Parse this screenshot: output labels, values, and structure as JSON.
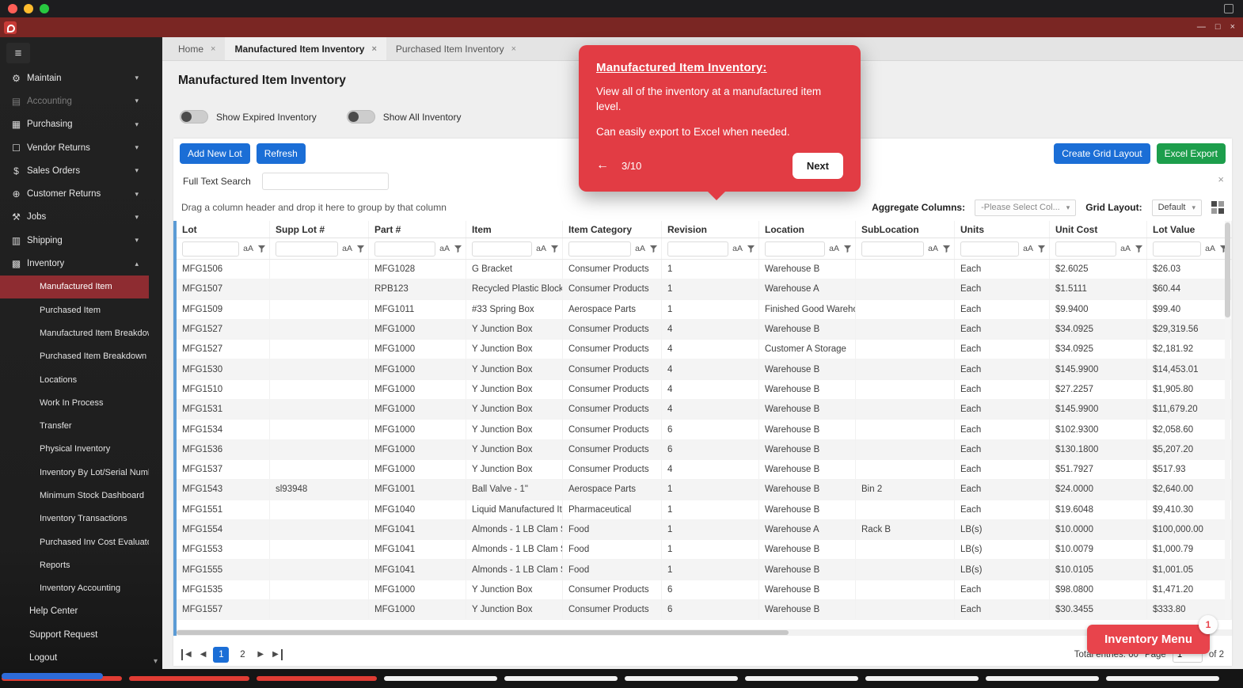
{
  "colors": {
    "primary_blue": "#1b6ed6",
    "export_green": "#1d9e4c",
    "tooltip_red": "#e23c44",
    "titlebar_maroon": "#7a2623",
    "sidebar_selected_red": "#8e2c31",
    "menu_button_red": "#e8444c",
    "accent_bar_blue": "#5b9bd5",
    "traffic_red": "#ff5f57",
    "traffic_yellow": "#febc2e",
    "traffic_green": "#28c840"
  },
  "icons": {
    "menu": "≡",
    "gear": "⚙",
    "folder": "▤",
    "purchasing": "▦",
    "vendor": "☐",
    "dollar": "$",
    "globe": "⊕",
    "wrench": "⚒",
    "shipping": "▥",
    "inventory": "▩",
    "chevron_down": "▾",
    "chevron_up": "▴",
    "close": "×",
    "minimize": "—",
    "restore": "□",
    "back_arrow": "←",
    "caret_down": "▾",
    "pager_prev": "◀",
    "pager_next": "▶"
  },
  "sidebar": {
    "sections": [
      {
        "label": "Maintain",
        "icon": "gear"
      },
      {
        "label": "Accounting",
        "icon": "folder",
        "disabled": true
      },
      {
        "label": "Purchasing",
        "icon": "purchasing"
      },
      {
        "label": "Vendor Returns",
        "icon": "vendor"
      },
      {
        "label": "Sales Orders",
        "icon": "dollar"
      },
      {
        "label": "Customer Returns",
        "icon": "globe"
      },
      {
        "label": "Jobs",
        "icon": "wrench"
      },
      {
        "label": "Shipping",
        "icon": "shipping"
      },
      {
        "label": "Inventory",
        "icon": "inventory",
        "expanded": true
      }
    ],
    "inventory_items": [
      "Manufactured Item",
      "Purchased Item",
      "Manufactured Item Breakdow",
      "Purchased Item Breakdown",
      "Locations",
      "Work In Process",
      "Transfer",
      "Physical Inventory",
      "Inventory By Lot/Serial Numb",
      "Minimum Stock Dashboard",
      "Inventory Transactions",
      "Purchased Inv Cost Evaluator",
      "Reports",
      "Inventory Accounting"
    ],
    "active_index": 0,
    "footer_items": [
      "Help Center",
      "Support Request",
      "Logout"
    ]
  },
  "tabs": [
    {
      "label": "Home"
    },
    {
      "label": "Manufactured Item Inventory",
      "active": true
    },
    {
      "label": "Purchased Item Inventory"
    }
  ],
  "page": {
    "title": "Manufactured Item Inventory"
  },
  "toggles": [
    {
      "label": "Show Expired Inventory",
      "on": false
    },
    {
      "label": "Show All Inventory",
      "on": false
    }
  ],
  "toolbar": {
    "add_new_lot": "Add New Lot",
    "refresh": "Refresh",
    "create_grid_layout": "Create Grid Layout",
    "excel_export": "Excel Export"
  },
  "search": {
    "label": "Full Text Search",
    "value": ""
  },
  "group_hint": "Drag a column header and drop it here to group by that column",
  "aggregate": {
    "label": "Aggregate Columns:",
    "value": "-Please Select Col..."
  },
  "grid_layout": {
    "label": "Grid Layout:",
    "value": "Default"
  },
  "grid": {
    "columns": [
      "Lot",
      "Supp Lot #",
      "Part #",
      "Item",
      "Item Category",
      "Revision",
      "Location",
      "SubLocation",
      "Units",
      "Unit Cost",
      "Lot Value"
    ],
    "filter_case_label": "aA",
    "rows": [
      [
        "MFG1506",
        "",
        "MFG1028",
        "G Bracket",
        "Consumer Products",
        "1",
        "Warehouse B",
        "",
        "Each",
        "$2.6025",
        "$26.03"
      ],
      [
        "MFG1507",
        "",
        "RPB123",
        "Recycled Plastic Block",
        "Consumer Products",
        "1",
        "Warehouse A",
        "",
        "Each",
        "$1.5111",
        "$60.44"
      ],
      [
        "MFG1509",
        "",
        "MFG1011",
        "#33 Spring Box",
        "Aerospace Parts",
        "1",
        "Finished Good Wareho",
        "",
        "Each",
        "$9.9400",
        "$99.40"
      ],
      [
        "MFG1527",
        "",
        "MFG1000",
        "Y Junction Box",
        "Consumer Products",
        "4",
        "Warehouse B",
        "",
        "Each",
        "$34.0925",
        "$29,319.56"
      ],
      [
        "MFG1527",
        "",
        "MFG1000",
        "Y Junction Box",
        "Consumer Products",
        "4",
        "Customer A Storage",
        "",
        "Each",
        "$34.0925",
        "$2,181.92"
      ],
      [
        "MFG1530",
        "",
        "MFG1000",
        "Y Junction Box",
        "Consumer Products",
        "4",
        "Warehouse B",
        "",
        "Each",
        "$145.9900",
        "$14,453.01"
      ],
      [
        "MFG1510",
        "",
        "MFG1000",
        "Y Junction Box",
        "Consumer Products",
        "4",
        "Warehouse B",
        "",
        "Each",
        "$27.2257",
        "$1,905.80"
      ],
      [
        "MFG1531",
        "",
        "MFG1000",
        "Y Junction Box",
        "Consumer Products",
        "4",
        "Warehouse B",
        "",
        "Each",
        "$145.9900",
        "$11,679.20"
      ],
      [
        "MFG1534",
        "",
        "MFG1000",
        "Y Junction Box",
        "Consumer Products",
        "6",
        "Warehouse B",
        "",
        "Each",
        "$102.9300",
        "$2,058.60"
      ],
      [
        "MFG1536",
        "",
        "MFG1000",
        "Y Junction Box",
        "Consumer Products",
        "6",
        "Warehouse B",
        "",
        "Each",
        "$130.1800",
        "$5,207.20"
      ],
      [
        "MFG1537",
        "",
        "MFG1000",
        "Y Junction Box",
        "Consumer Products",
        "4",
        "Warehouse B",
        "",
        "Each",
        "$51.7927",
        "$517.93"
      ],
      [
        "MFG1543",
        "sl93948",
        "MFG1001",
        "Ball Valve - 1\"",
        "Aerospace Parts",
        "1",
        "Warehouse B",
        "Bin 2",
        "Each",
        "$24.0000",
        "$2,640.00"
      ],
      [
        "MFG1551",
        "",
        "MFG1040",
        "Liquid Manufactured It",
        "Pharmaceutical",
        "1",
        "Warehouse B",
        "",
        "Each",
        "$19.6048",
        "$9,410.30"
      ],
      [
        "MFG1554",
        "",
        "MFG1041",
        "Almonds - 1 LB Clam S",
        "Food",
        "1",
        "Warehouse A",
        "Rack B",
        "LB(s)",
        "$10.0000",
        "$100,000.00"
      ],
      [
        "MFG1553",
        "",
        "MFG1041",
        "Almonds - 1 LB Clam S",
        "Food",
        "1",
        "Warehouse B",
        "",
        "LB(s)",
        "$10.0079",
        "$1,000.79"
      ],
      [
        "MFG1555",
        "",
        "MFG1041",
        "Almonds - 1 LB Clam S",
        "Food",
        "1",
        "Warehouse B",
        "",
        "LB(s)",
        "$10.0105",
        "$1,001.05"
      ],
      [
        "MFG1535",
        "",
        "MFG1000",
        "Y Junction Box",
        "Consumer Products",
        "6",
        "Warehouse B",
        "",
        "Each",
        "$98.0800",
        "$1,471.20"
      ],
      [
        "MFG1557",
        "",
        "MFG1000",
        "Y Junction Box",
        "Consumer Products",
        "6",
        "Warehouse B",
        "",
        "Each",
        "$30.3455",
        "$333.80"
      ]
    ]
  },
  "pager": {
    "pages": [
      "1",
      "2"
    ],
    "current": "1"
  },
  "footer": {
    "total_entries": "Total entries: 60",
    "page_label": "Page",
    "page_value": "1",
    "of_label": "of 2"
  },
  "inventory_menu": {
    "label": "Inventory Menu",
    "badge": "1"
  },
  "tooltip": {
    "title": "Manufactured Item Inventory:",
    "body": [
      "View all of the inventory at a manufactured item level.",
      "Can easily export to Excel when needed."
    ],
    "step": "3/10",
    "next_label": "Next"
  },
  "bottom_bar": {
    "red_segments": 3,
    "white_segments": 7
  }
}
